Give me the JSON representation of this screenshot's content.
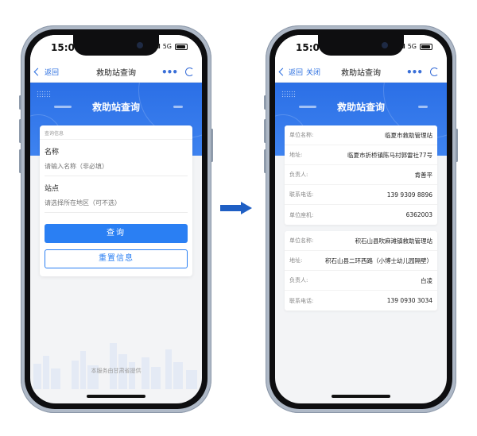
{
  "colors": {
    "primary": "#2a7ff3",
    "banner": "#2b6fe6",
    "arrow": "#1f5fc4"
  },
  "left_phone": {
    "status": {
      "time": "15:06",
      "network": "5G"
    },
    "nav": {
      "back_label": "返回",
      "title": "救助站查询"
    },
    "banner_title": "救助站查询",
    "form": {
      "section_label": "查询信息",
      "name_label": "名称",
      "name_placeholder": "请输入名称（非必填）",
      "station_label": "站点",
      "station_placeholder": "请选择所在地区（可不选）",
      "query_button": "查询",
      "reset_button": "重置信息"
    },
    "footer": "本服务由甘肃省提供"
  },
  "right_phone": {
    "status": {
      "time": "15:06",
      "network": "5G"
    },
    "nav": {
      "back_label": "返回",
      "close_label": "关闭",
      "title": "救助站查询"
    },
    "banner_title": "救助站查询",
    "results": [
      {
        "rows": [
          {
            "k": "单位名称:",
            "v": "临夏市救助管理站"
          },
          {
            "k": "地址:",
            "v": "临夏市折桥镇陈马村郭雷社77号"
          },
          {
            "k": "负责人:",
            "v": "肯善平"
          },
          {
            "k": "联系电话:",
            "v": "139 9309 8896"
          },
          {
            "k": "单位座机:",
            "v": "6362003"
          }
        ]
      },
      {
        "rows": [
          {
            "k": "单位名称:",
            "v": "积石山县吹麻滩镇救助管理站"
          },
          {
            "k": "地址:",
            "v": "积石山县二环西路（小博士幼儿园隔壁）"
          },
          {
            "k": "负责人:",
            "v": "白凌"
          },
          {
            "k": "联系电话:",
            "v": "139 0930 3034"
          }
        ]
      }
    ]
  }
}
